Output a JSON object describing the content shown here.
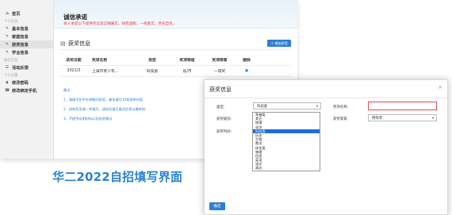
{
  "sidebar": {
    "home": "首页",
    "group_personal": "个人信息",
    "items": [
      {
        "label": "基本信息",
        "icon": "edit-icon"
      },
      {
        "label": "家庭信息",
        "icon": "edit-icon"
      },
      {
        "label": "获奖信息",
        "icon": "edit-icon",
        "active": true
      },
      {
        "label": "学业信息",
        "icon": "edit-icon"
      }
    ],
    "group_enroll": "报名信息",
    "enroll_item": "活动反馈",
    "group_center": "个人设置",
    "settings": [
      {
        "label": "修改密码",
        "icon": "lock-icon"
      },
      {
        "label": "修改绑定手机",
        "icon": "phone-icon"
      }
    ]
  },
  "banner": {
    "title": "诚信承诺",
    "text": "本人承诺以下提供的信息正确属实，如有虚假，一经查实，责任自负。"
  },
  "section": {
    "title": "获奖信息",
    "add_button": "+ 增加获奖"
  },
  "table": {
    "headers": [
      "获奖日期",
      "奖项名称",
      "类型",
      "奖项等级",
      "奖项等第",
      "删除"
    ],
    "rows": [
      [
        "2021/3",
        "上海市青少年...",
        "科技类",
        "省/市",
        "一等奖"
      ]
    ]
  },
  "notes": {
    "label": "备注:",
    "lines": [
      "1、请填写初中在校期间获奖，最多填写10条相关内容",
      "2、如有奖项请一并填写，请如实填写真实信息以备审核",
      "3、不提供证明材料以及相关情况"
    ]
  },
  "caption": "华二2022自招填写界面",
  "modal": {
    "title": "获奖信息",
    "close": "×",
    "type_label": "类型:",
    "type_value": "科技类",
    "award_name_label": "奖项名称:",
    "award_level_label": "获奖级别:",
    "award_time_label": "获奖时间:",
    "award_grade_label": "获奖等第:",
    "award_grade_value": "特等奖",
    "confirm": "确定",
    "options": [
      "荣誉类",
      "其它",
      "地理",
      "化学",
      "科技类",
      "历史",
      "生物",
      "数学",
      "体艺类",
      "物理",
      "信息",
      "英语",
      "语文",
      "政治"
    ],
    "selected_option": "科技类"
  }
}
